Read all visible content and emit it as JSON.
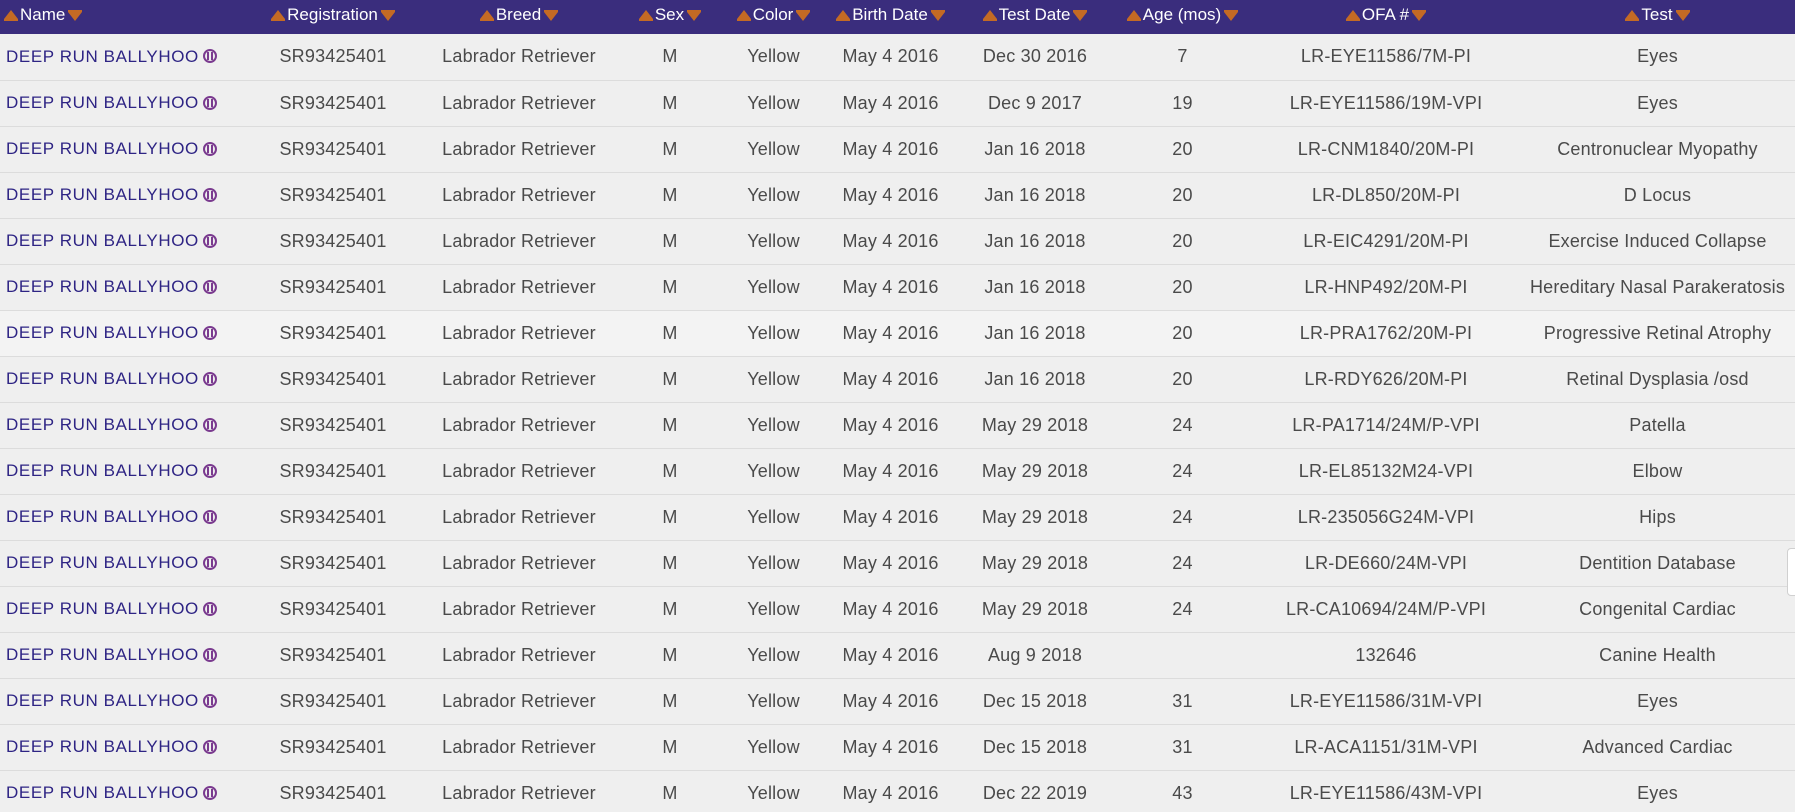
{
  "table": {
    "headers": [
      {
        "key": "name",
        "label": "Name"
      },
      {
        "key": "registration",
        "label": "Registration"
      },
      {
        "key": "breed",
        "label": "Breed"
      },
      {
        "key": "sex",
        "label": "Sex"
      },
      {
        "key": "color",
        "label": "Color"
      },
      {
        "key": "birth_date",
        "label": "Birth Date"
      },
      {
        "key": "test_date",
        "label": "Test Date"
      },
      {
        "key": "age",
        "label": "Age (mos)"
      },
      {
        "key": "ofa",
        "label": "OFA #"
      },
      {
        "key": "test",
        "label": "Test"
      }
    ],
    "rows": [
      {
        "name": "DEEP RUN BALLYHOO",
        "registration": "SR93425401",
        "breed": "Labrador Retriever",
        "sex": "M",
        "color": "Yellow",
        "birth_date": "May 4 2016",
        "test_date": "Dec 30 2016",
        "age": "7",
        "ofa": "LR-EYE11586/7M-PI",
        "test": "Eyes"
      },
      {
        "name": "DEEP RUN BALLYHOO",
        "registration": "SR93425401",
        "breed": "Labrador Retriever",
        "sex": "M",
        "color": "Yellow",
        "birth_date": "May 4 2016",
        "test_date": "Dec 9 2017",
        "age": "19",
        "ofa": "LR-EYE11586/19M-VPI",
        "test": "Eyes"
      },
      {
        "name": "DEEP RUN BALLYHOO",
        "registration": "SR93425401",
        "breed": "Labrador Retriever",
        "sex": "M",
        "color": "Yellow",
        "birth_date": "May 4 2016",
        "test_date": "Jan 16 2018",
        "age": "20",
        "ofa": "LR-CNM1840/20M-PI",
        "test": "Centronuclear Myopathy"
      },
      {
        "name": "DEEP RUN BALLYHOO",
        "registration": "SR93425401",
        "breed": "Labrador Retriever",
        "sex": "M",
        "color": "Yellow",
        "birth_date": "May 4 2016",
        "test_date": "Jan 16 2018",
        "age": "20",
        "ofa": "LR-DL850/20M-PI",
        "test": "D Locus"
      },
      {
        "name": "DEEP RUN BALLYHOO",
        "registration": "SR93425401",
        "breed": "Labrador Retriever",
        "sex": "M",
        "color": "Yellow",
        "birth_date": "May 4 2016",
        "test_date": "Jan 16 2018",
        "age": "20",
        "ofa": "LR-EIC4291/20M-PI",
        "test": "Exercise Induced Collapse"
      },
      {
        "name": "DEEP RUN BALLYHOO",
        "registration": "SR93425401",
        "breed": "Labrador Retriever",
        "sex": "M",
        "color": "Yellow",
        "birth_date": "May 4 2016",
        "test_date": "Jan 16 2018",
        "age": "20",
        "ofa": "LR-HNP492/20M-PI",
        "test": "Hereditary Nasal Parakeratosis"
      },
      {
        "name": "DEEP RUN BALLYHOO",
        "registration": "SR93425401",
        "breed": "Labrador Retriever",
        "sex": "M",
        "color": "Yellow",
        "birth_date": "May 4 2016",
        "test_date": "Jan 16 2018",
        "age": "20",
        "ofa": "LR-PRA1762/20M-PI",
        "test": "Progressive Retinal Atrophy"
      },
      {
        "name": "DEEP RUN BALLYHOO",
        "registration": "SR93425401",
        "breed": "Labrador Retriever",
        "sex": "M",
        "color": "Yellow",
        "birth_date": "May 4 2016",
        "test_date": "Jan 16 2018",
        "age": "20",
        "ofa": "LR-RDY626/20M-PI",
        "test": "Retinal Dysplasia /osd"
      },
      {
        "name": "DEEP RUN BALLYHOO",
        "registration": "SR93425401",
        "breed": "Labrador Retriever",
        "sex": "M",
        "color": "Yellow",
        "birth_date": "May 4 2016",
        "test_date": "May 29 2018",
        "age": "24",
        "ofa": "LR-PA1714/24M/P-VPI",
        "test": "Patella"
      },
      {
        "name": "DEEP RUN BALLYHOO",
        "registration": "SR93425401",
        "breed": "Labrador Retriever",
        "sex": "M",
        "color": "Yellow",
        "birth_date": "May 4 2016",
        "test_date": "May 29 2018",
        "age": "24",
        "ofa": "LR-EL85132M24-VPI",
        "test": "Elbow"
      },
      {
        "name": "DEEP RUN BALLYHOO",
        "registration": "SR93425401",
        "breed": "Labrador Retriever",
        "sex": "M",
        "color": "Yellow",
        "birth_date": "May 4 2016",
        "test_date": "May 29 2018",
        "age": "24",
        "ofa": "LR-235056G24M-VPI",
        "test": "Hips"
      },
      {
        "name": "DEEP RUN BALLYHOO",
        "registration": "SR93425401",
        "breed": "Labrador Retriever",
        "sex": "M",
        "color": "Yellow",
        "birth_date": "May 4 2016",
        "test_date": "May 29 2018",
        "age": "24",
        "ofa": "LR-DE660/24M-VPI",
        "test": "Dentition Database"
      },
      {
        "name": "DEEP RUN BALLYHOO",
        "registration": "SR93425401",
        "breed": "Labrador Retriever",
        "sex": "M",
        "color": "Yellow",
        "birth_date": "May 4 2016",
        "test_date": "May 29 2018",
        "age": "24",
        "ofa": "LR-CA10694/24M/P-VPI",
        "test": "Congenital Cardiac"
      },
      {
        "name": "DEEP RUN BALLYHOO",
        "registration": "SR93425401",
        "breed": "Labrador Retriever",
        "sex": "M",
        "color": "Yellow",
        "birth_date": "May 4 2016",
        "test_date": "Aug 9 2018",
        "age": "",
        "ofa": "132646",
        "test": "Canine Health"
      },
      {
        "name": "DEEP RUN BALLYHOO",
        "registration": "SR93425401",
        "breed": "Labrador Retriever",
        "sex": "M",
        "color": "Yellow",
        "birth_date": "May 4 2016",
        "test_date": "Dec 15 2018",
        "age": "31",
        "ofa": "LR-EYE11586/31M-VPI",
        "test": "Eyes"
      },
      {
        "name": "DEEP RUN BALLYHOO",
        "registration": "SR93425401",
        "breed": "Labrador Retriever",
        "sex": "M",
        "color": "Yellow",
        "birth_date": "May 4 2016",
        "test_date": "Dec 15 2018",
        "age": "31",
        "ofa": "LR-ACA1151/31M-VPI",
        "test": "Advanced Cardiac"
      },
      {
        "name": "DEEP RUN BALLYHOO",
        "registration": "SR93425401",
        "breed": "Labrador Retriever",
        "sex": "M",
        "color": "Yellow",
        "birth_date": "May 4 2016",
        "test_date": "Dec 22 2019",
        "age": "43",
        "ofa": "LR-EYE11586/43M-VPI",
        "test": "Eyes"
      }
    ]
  },
  "icons": {
    "sort_ascending": "sort-ascending-icon",
    "sort_descending": "sort-descending-icon",
    "certificate": "certificate-icon"
  },
  "colors": {
    "header_bg": "#3a2d7d",
    "sort_arrow": "#c46a24",
    "name_link": "#2e2484",
    "cert_icon": "#7a3a8f"
  }
}
